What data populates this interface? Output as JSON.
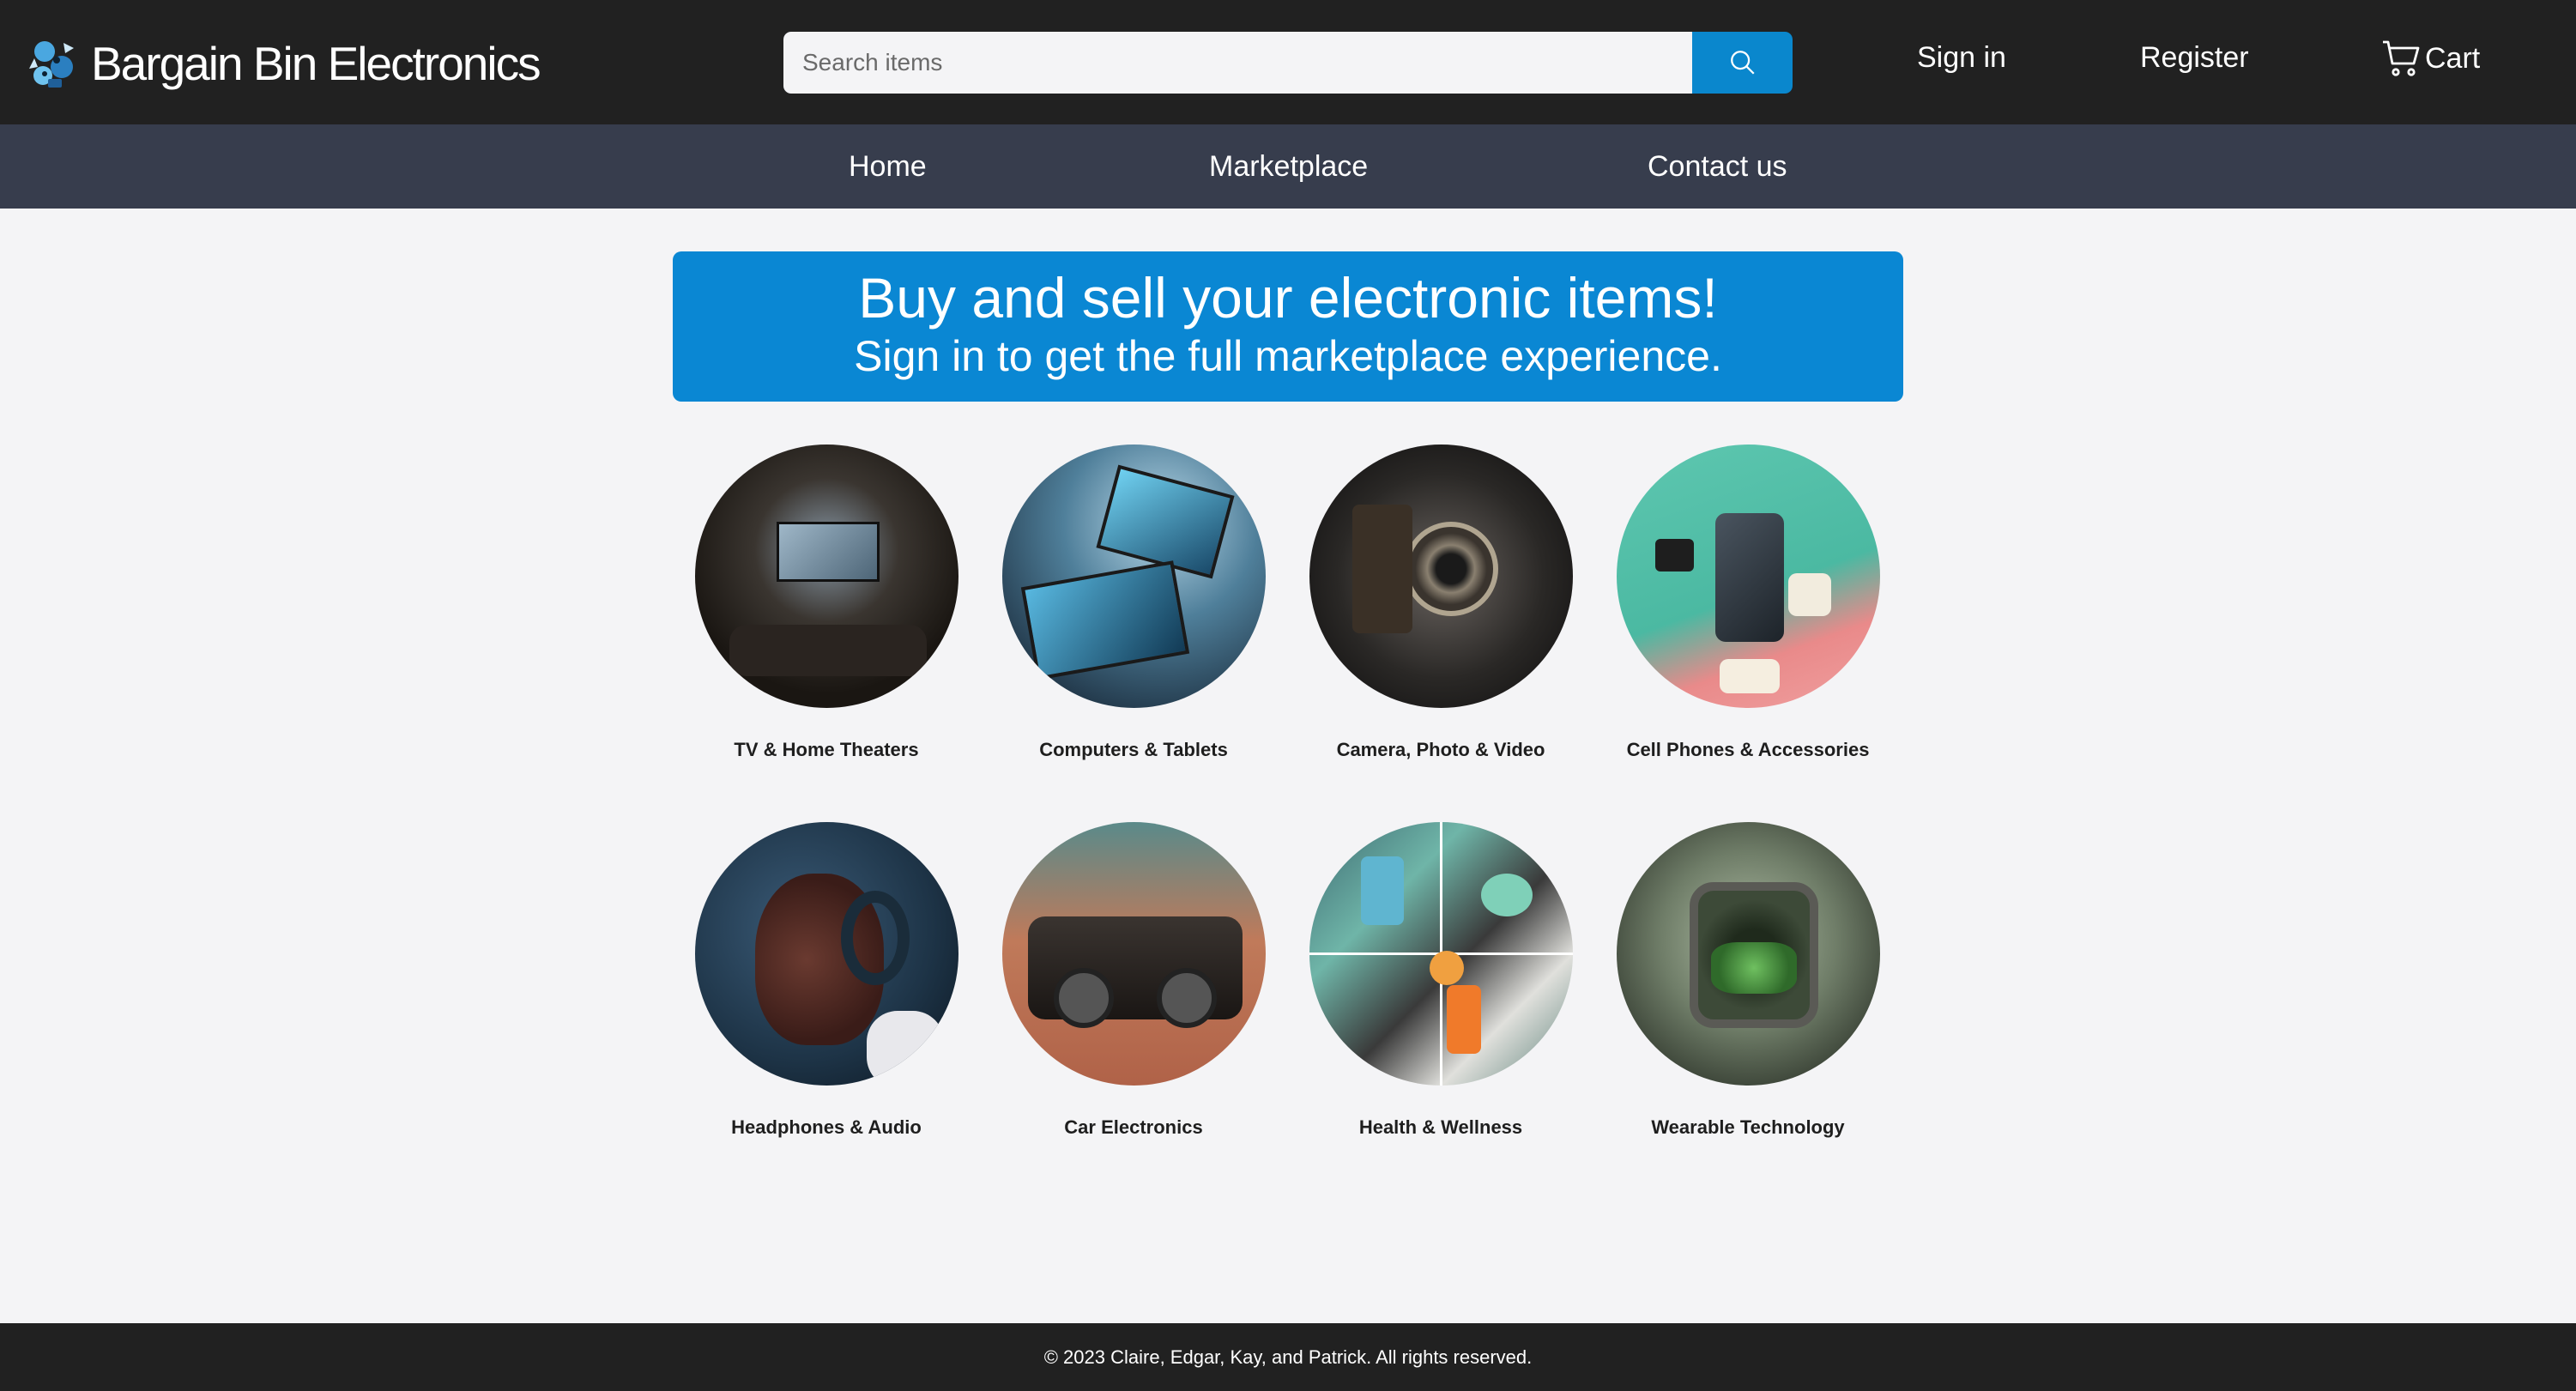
{
  "header": {
    "brand": "Bargain Bin Electronics",
    "search_placeholder": "Search items",
    "sign_in": "Sign in",
    "register": "Register",
    "cart": "Cart"
  },
  "nav": {
    "home": "Home",
    "marketplace": "Marketplace",
    "contact": "Contact us"
  },
  "hero": {
    "title": "Buy and sell your electronic items!",
    "subtitle": "Sign in to get the full marketplace experience."
  },
  "categories": [
    {
      "label": "TV & Home Theaters"
    },
    {
      "label": "Computers & Tablets"
    },
    {
      "label": "Camera, Photo & Video"
    },
    {
      "label": "Cell Phones & Accessories"
    },
    {
      "label": "Headphones & Audio"
    },
    {
      "label": "Car Electronics"
    },
    {
      "label": "Health & Wellness"
    },
    {
      "label": "Wearable Technology"
    }
  ],
  "footer": {
    "copyright": "© 2023 Claire, Edgar, Kay, and Patrick. All rights reserved."
  },
  "colors": {
    "header_bg": "#212121",
    "subnav_bg": "#373d4d",
    "accent": "#0a87d3",
    "page_bg": "#f4f4f6"
  }
}
